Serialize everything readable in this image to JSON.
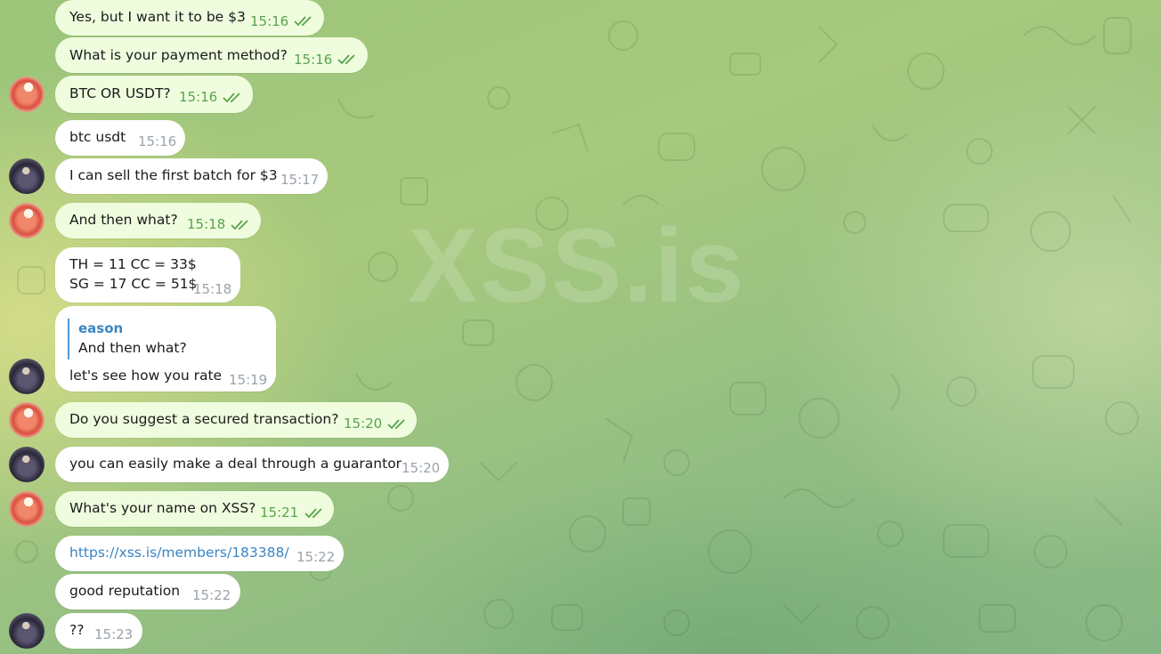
{
  "watermark": "XSS.is",
  "colors": {
    "outgoing_bubble": "#effdde",
    "incoming_bubble": "#ffffff",
    "outgoing_time": "#58a34e",
    "incoming_time": "#9aa3ab",
    "link": "#3a86c4"
  },
  "messages": [
    {
      "direction": "outgoing",
      "lines": [
        "Yes, but I want it to be $3"
      ],
      "time": "15:16",
      "status": "read"
    },
    {
      "direction": "outgoing",
      "lines": [
        "What is your payment method?"
      ],
      "time": "15:16",
      "status": "read"
    },
    {
      "direction": "outgoing",
      "lines": [
        "BTC OR USDT?"
      ],
      "time": "15:16",
      "status": "read"
    },
    {
      "direction": "incoming",
      "lines": [
        "btc usdt"
      ],
      "time": "15:16"
    },
    {
      "direction": "incoming",
      "lines": [
        "I can sell the first batch for $3"
      ],
      "time": "15:17"
    },
    {
      "direction": "outgoing",
      "lines": [
        "And then what?"
      ],
      "time": "15:18",
      "status": "read"
    },
    {
      "direction": "incoming",
      "lines": [
        "TH = 11 CC = 33$",
        "SG = 17 CC = 51$"
      ],
      "time": "15:18"
    },
    {
      "direction": "incoming",
      "reply_to": {
        "name": "eason",
        "text": "And then what?"
      },
      "lines": [
        "let's see how you rate"
      ],
      "time": "15:19"
    },
    {
      "direction": "outgoing",
      "lines": [
        "Do you suggest a secured transaction?"
      ],
      "time": "15:20",
      "status": "read"
    },
    {
      "direction": "incoming",
      "lines": [
        "you can easily make a deal through a guarantor"
      ],
      "time": "15:20"
    },
    {
      "direction": "outgoing",
      "lines": [
        "What's your name on XSS?"
      ],
      "time": "15:21",
      "status": "read"
    },
    {
      "direction": "incoming",
      "lines": [
        "https://xss.is/members/183388/"
      ],
      "time": "15:22",
      "is_link": true
    },
    {
      "direction": "incoming",
      "lines": [
        "good reputation"
      ],
      "time": "15:22"
    },
    {
      "direction": "incoming",
      "lines": [
        "??"
      ],
      "time": "15:23"
    }
  ],
  "avatars": [
    {
      "icon": "red-character-avatar"
    },
    {
      "icon": "dark-character-avatar"
    },
    {
      "icon": "red-character-avatar"
    },
    {
      "icon": "dark-character-avatar"
    },
    {
      "icon": "red-character-avatar"
    },
    {
      "icon": "dark-character-avatar"
    },
    {
      "icon": "red-character-avatar"
    },
    {
      "icon": "dark-character-avatar"
    }
  ]
}
